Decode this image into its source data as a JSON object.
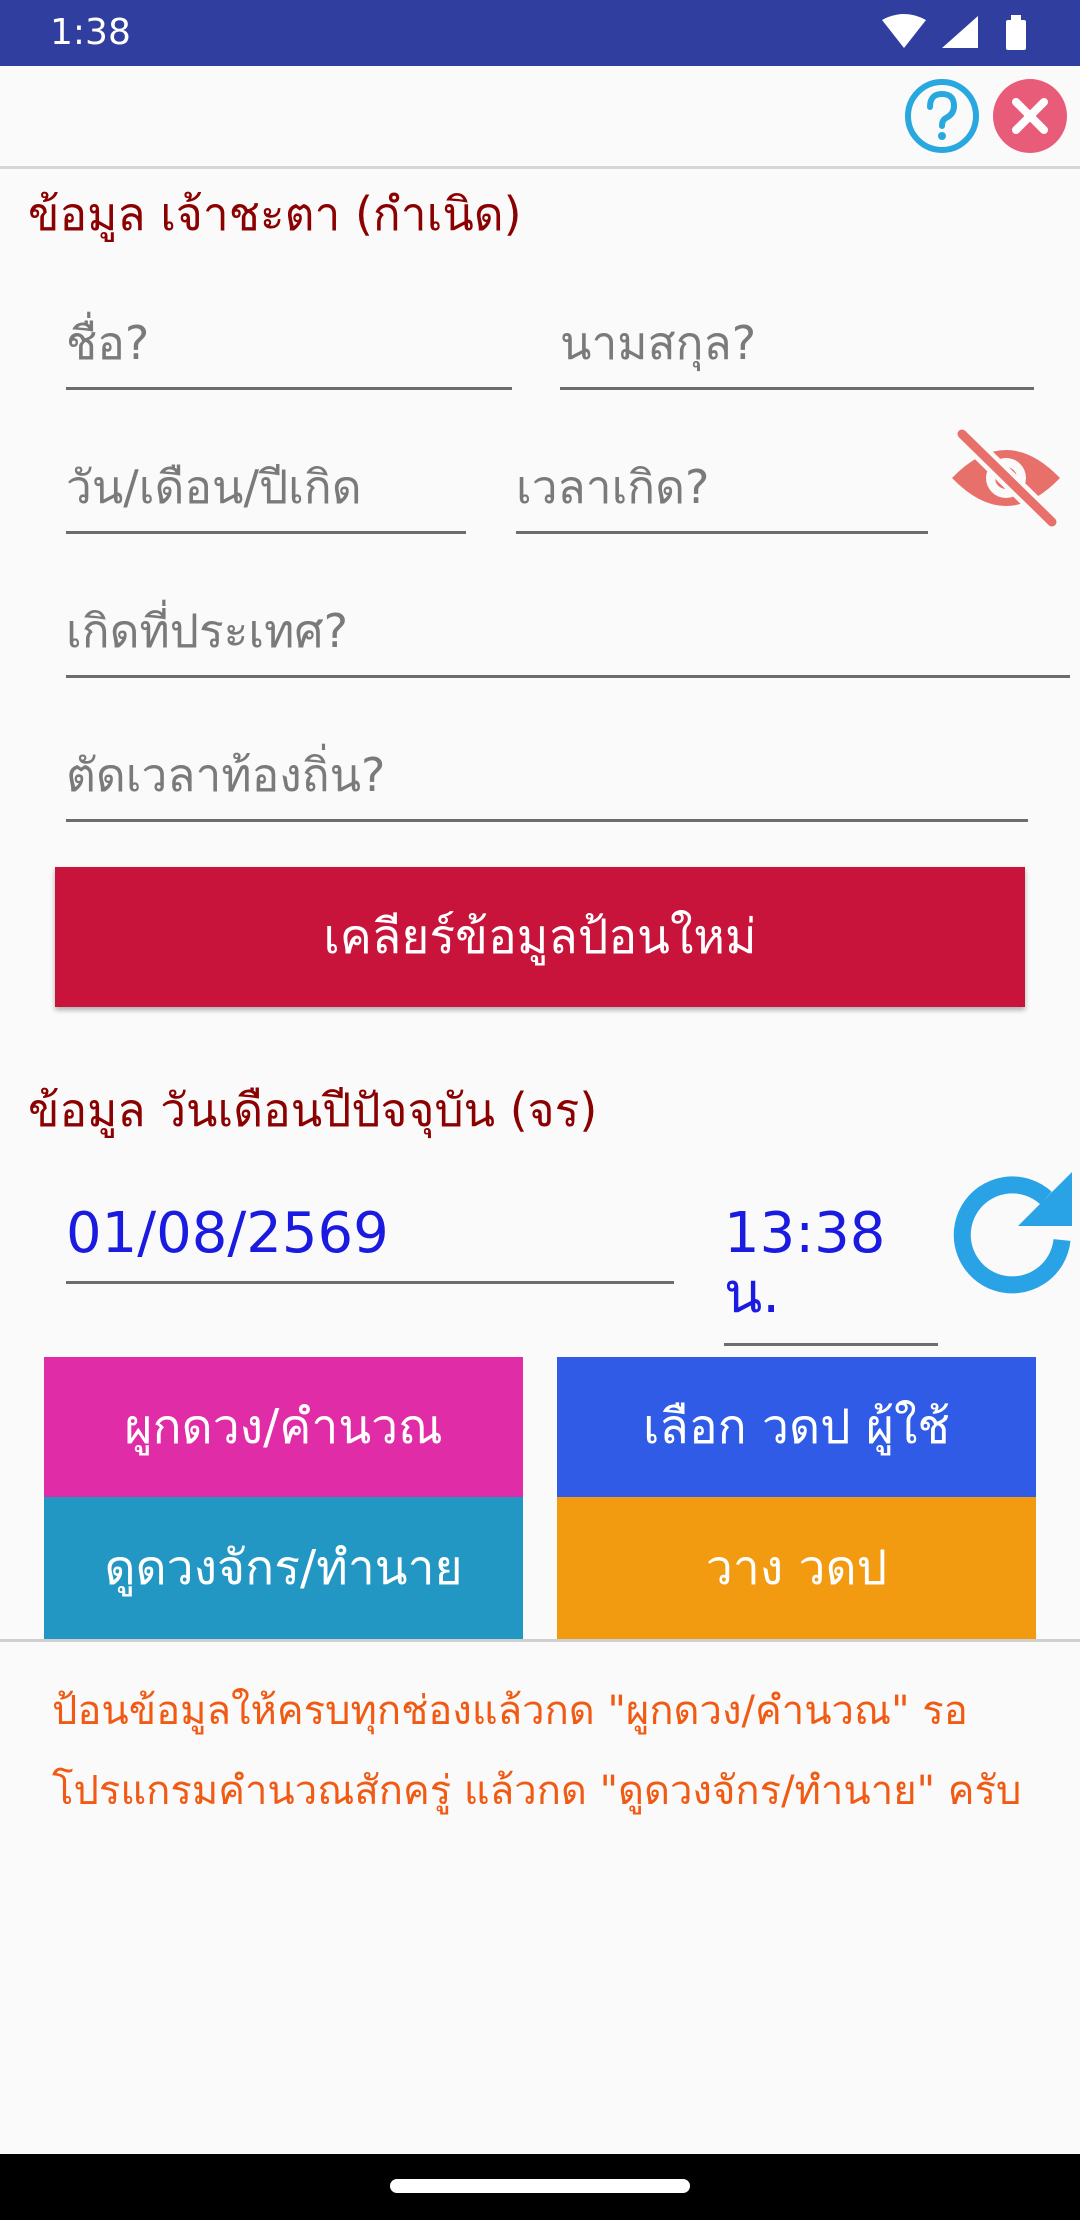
{
  "status_bar": {
    "time": "1:38",
    "icons": [
      "wifi-icon",
      "signal-icon",
      "battery-icon"
    ],
    "color": "#303f9f"
  },
  "header": {
    "icons": [
      "help-icon",
      "close-icon"
    ],
    "help_color": "#29a8e0",
    "close_color": "#e85c7a"
  },
  "birth_section": {
    "title": "ข้อมูล เจ้าชะตา (กำเนิด)",
    "name_placeholder": "ชื่อ?",
    "surname_placeholder": "นามสกุล?",
    "birthdate_placeholder": "วัน/เดือน/ปีเกิด",
    "birthtime_placeholder": "เวลาเกิด?",
    "country_placeholder": "เกิดที่ประเทศ?",
    "localtime_placeholder": "ตัดเวลาท้องถิ่น?",
    "visibility_icon": "visibility-off-icon",
    "clear_button": "เคลียร์ข้อมูลป้อนใหม่"
  },
  "current_section": {
    "title": "ข้อมูล วันเดือนปีปัจจุบัน (จร)",
    "date": "01/08/2569",
    "time": "13:38",
    "time_unit": "น.",
    "refresh_icon": "refresh-icon"
  },
  "actions": {
    "calc": "ผูกดวง/คำนวณ",
    "select_user": "เลือก วดป ผู้ใช้",
    "predict": "ดูดวงจักร/ทำนาย",
    "place": "วาง วดป"
  },
  "instruction": {
    "line1": "ป้อนข้อมูลให้ครบทุกช่องแล้วกด \"ผูกดวง/คำนวณ\" รอ",
    "line2": "โปรแกรมคำนวณสักครู่ แล้วกด \"ดูดวงจักร/ทำนาย\" ครับ"
  },
  "colors": {
    "section_title": "#8b0000",
    "clear_button": "#c8143b",
    "current_value": "#1a1ae0",
    "calc_button": "#e02ca6",
    "select_user_button": "#2f5be6",
    "predict_button": "#2297c3",
    "place_button": "#f29a10",
    "instruction": "#f05a13"
  }
}
